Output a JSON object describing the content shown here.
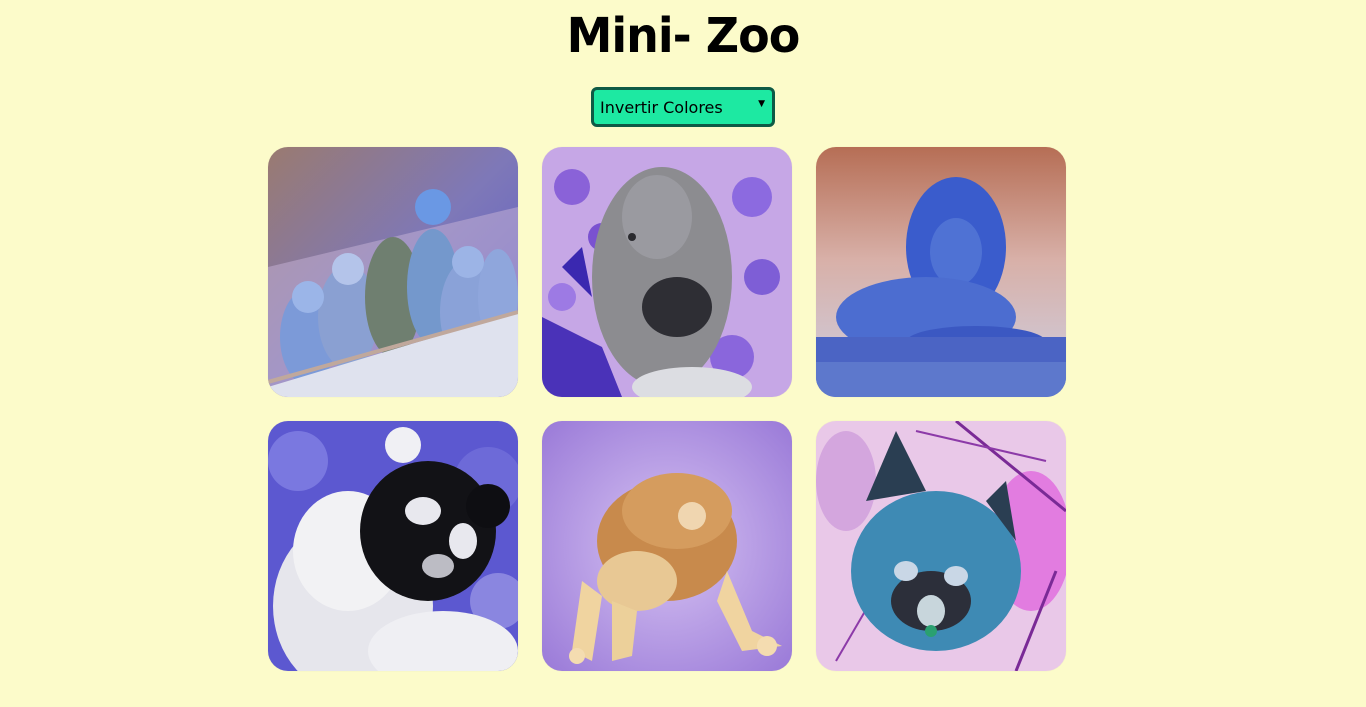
{
  "header": {
    "title": "Mini- Zoo"
  },
  "filter": {
    "selected_label": "Invertir Colores"
  },
  "gallery": {
    "images": [
      {
        "name": "birds-image",
        "subject": "birds"
      },
      {
        "name": "gorilla-image",
        "subject": "gorilla"
      },
      {
        "name": "lion-image",
        "subject": "lion"
      },
      {
        "name": "panda-image",
        "subject": "panda"
      },
      {
        "name": "frog-image",
        "subject": "frog"
      },
      {
        "name": "red-panda-image",
        "subject": "red panda"
      }
    ]
  },
  "colors": {
    "background": "#fcfbca",
    "select_bg": "#1de9a2",
    "select_border": "#0e5a45"
  }
}
